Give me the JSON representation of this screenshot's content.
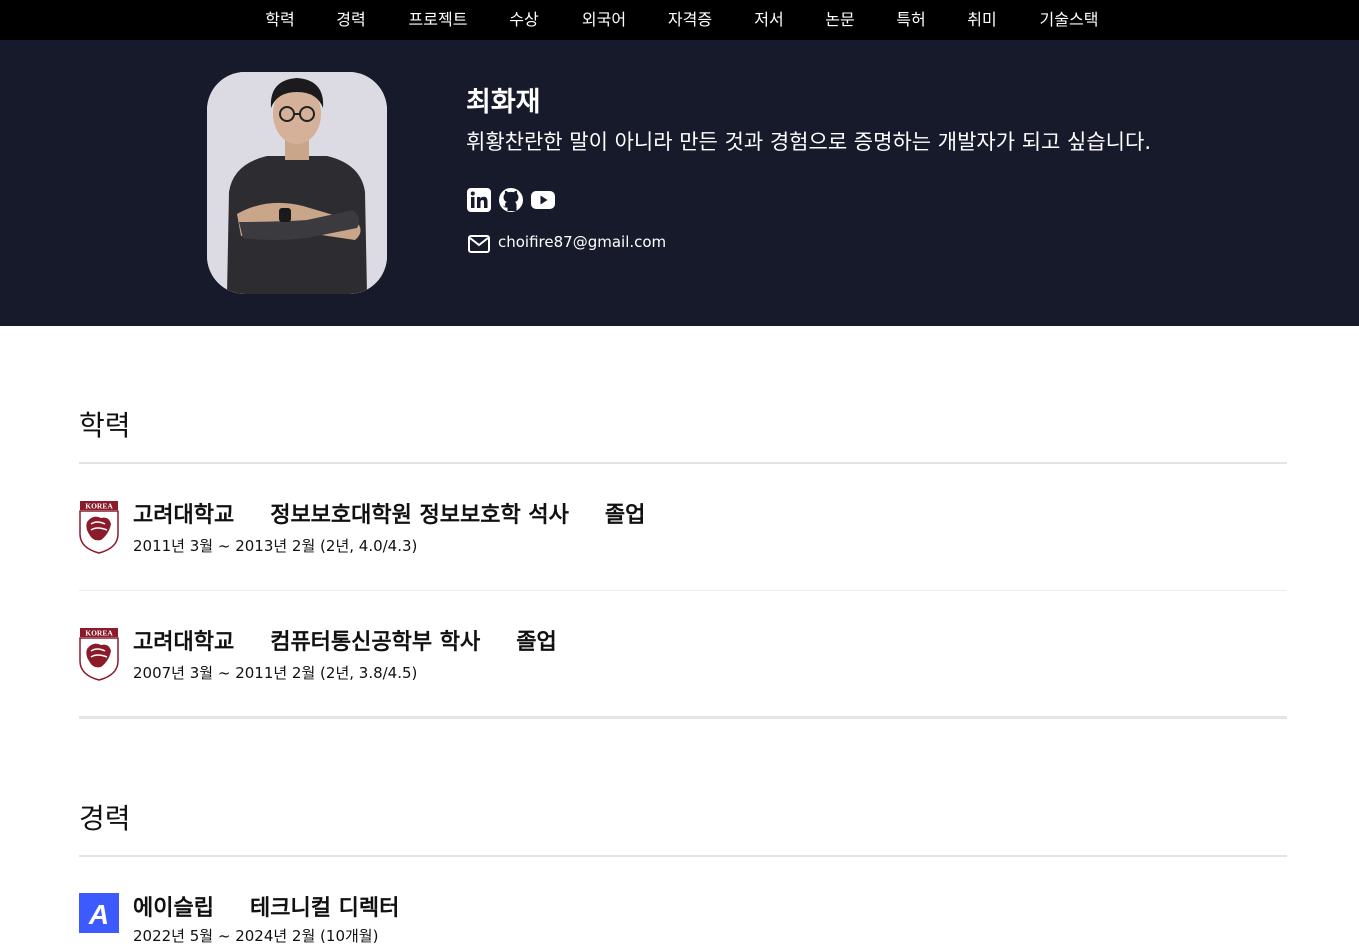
{
  "nav": {
    "items": [
      "학력",
      "경력",
      "프로젝트",
      "수상",
      "외국어",
      "자격증",
      "저서",
      "논문",
      "특허",
      "취미",
      "기술스택"
    ]
  },
  "profile": {
    "name": "최화재",
    "tagline": "휘황찬란한 말이 아니라 만든 것과 경험으로 증명하는 개발자가 되고 싶습니다.",
    "email": "choifire87@gmail.com",
    "social_icons": [
      "linkedin-icon",
      "github-icon",
      "youtube-icon"
    ]
  },
  "education": {
    "title": "학력",
    "entries": [
      {
        "school": "고려대학교",
        "program": "정보보호대학원 정보보호학 석사",
        "status": "졸업",
        "period": "2011년 3월 ~ 2013년 2월 (2년, 4.0/4.3)",
        "logo_text": "KOREA"
      },
      {
        "school": "고려대학교",
        "program": "컴퓨터통신공학부 학사",
        "status": "졸업",
        "period": "2007년 3월 ~ 2011년 2월 (2년, 3.8/4.5)",
        "logo_text": "KOREA"
      }
    ]
  },
  "career": {
    "title": "경력",
    "entries": [
      {
        "company": "에이슬립",
        "role": "테크니컬 디렉터",
        "period": "2022년 5월 ~ 2024년 2월 (10개월)",
        "logo_text": "A"
      }
    ]
  },
  "colors": {
    "nav_bg": "#000000",
    "header_bg": "#171a2b",
    "korea_univ_crimson": "#8b1a2b",
    "asleep_blue": "#3d5afe"
  }
}
